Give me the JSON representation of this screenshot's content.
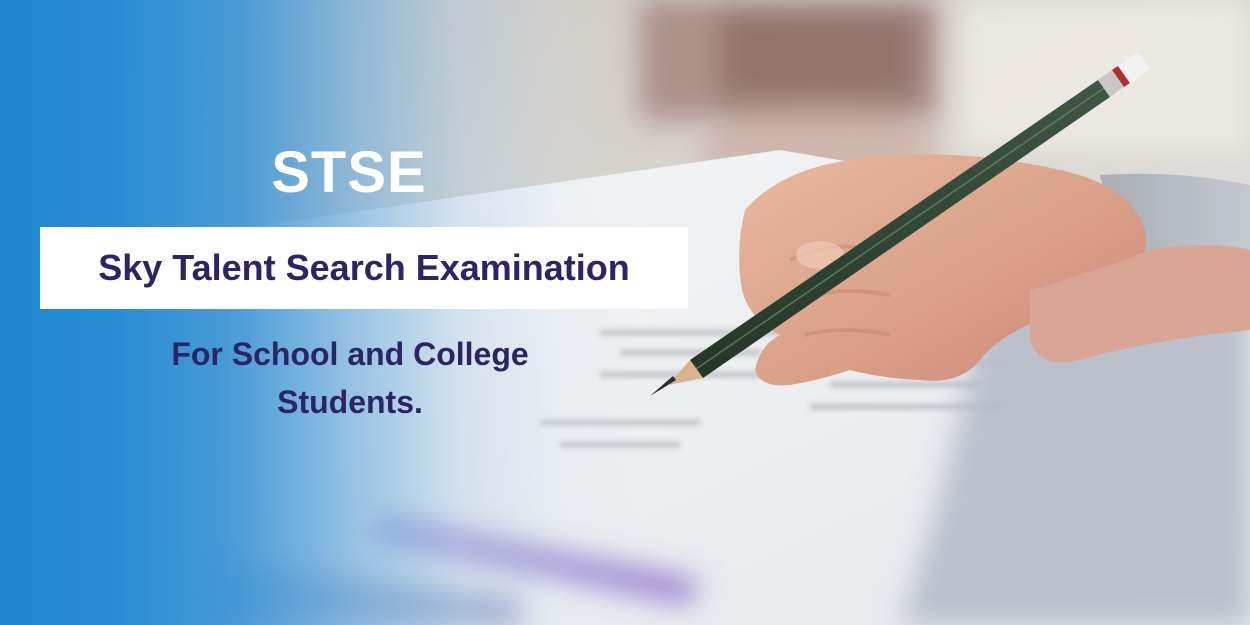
{
  "banner": {
    "title": "STSE",
    "exam_name": "Sky Talent Search Examination",
    "tagline": "For School and College Students."
  },
  "colors": {
    "blue_background": "#1f86cf",
    "title_text": "#ffffff",
    "name_text": "#2b2663",
    "name_box": "#ffffff",
    "tagline_text": "#2b2663"
  },
  "image": {
    "subject": "hand-writing-with-pencil-on-exam-sheet",
    "icon": "pencil-icon"
  }
}
